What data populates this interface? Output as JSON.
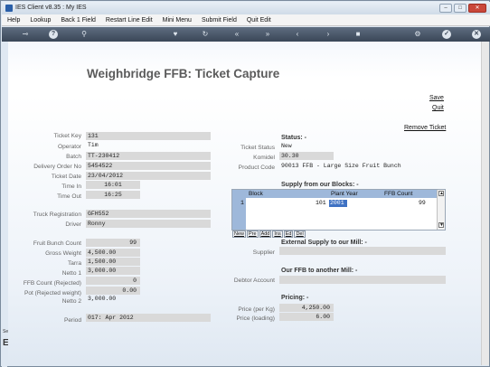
{
  "window": {
    "title": "IES Client v8.35 : My IES"
  },
  "menu": [
    "Help",
    "Lookup",
    "Back 1 Field",
    "Restart Line Edit",
    "Mini Menu",
    "Submit Field",
    "Quit Edit"
  ],
  "toolbar_icons": [
    "key-icon",
    "help-icon",
    "search-icon",
    "heart-icon",
    "refresh-icon",
    "rewind-icon",
    "fast-forward-icon",
    "back-icon",
    "forward-icon",
    "stop-icon",
    "settings-icon",
    "check-icon",
    "close-icon"
  ],
  "page": {
    "title": "Weighbridge FFB: Ticket Capture",
    "save": "Save",
    "quit": "Quit",
    "remove_ticket": "Remove Ticket"
  },
  "left": {
    "ticket_key": {
      "label": "Ticket Key",
      "value": "131"
    },
    "operator": {
      "label": "Operator",
      "value": "Tim"
    },
    "batch": {
      "label": "Batch",
      "value": "TT-230412"
    },
    "delivery_order_no": {
      "label": "Delivery Order No",
      "value": "5454522"
    },
    "ticket_date": {
      "label": "Ticket Date",
      "value": "23/04/2012"
    },
    "time_in": {
      "label": "Time In",
      "value": "16:01"
    },
    "time_out": {
      "label": "Time Out",
      "value": "16:25"
    },
    "truck_registration": {
      "label": "Truck Registration",
      "value": "GFH552"
    },
    "driver": {
      "label": "Driver",
      "value": "Ronny"
    },
    "fruit_bunch_count": {
      "label": "Fruit Bunch Count",
      "value": "99"
    },
    "gross_weight": {
      "label": "Gross Weight",
      "value": "4,500.00"
    },
    "tarra": {
      "label": "Tarra",
      "value": "1,500.00"
    },
    "netto_1": {
      "label": "Netto 1",
      "value": "3,000.00"
    },
    "ffb_count_rejected": {
      "label": "FFB Count (Rejected)",
      "value": "0"
    },
    "pot_rejected_weight": {
      "label": "Pot (Rejected weight)",
      "value": "0.00"
    },
    "netto_2": {
      "label": "Netto 2",
      "value": "3,000.00"
    },
    "period": {
      "label": "Period",
      "value": "017: Apr 2012"
    }
  },
  "right": {
    "status_heading": "Status: -",
    "ticket_status": {
      "label": "Ticket Status",
      "value": "New"
    },
    "komidel": {
      "label": "Komidel",
      "value": "30.30"
    },
    "product_code": {
      "label": "Product Code",
      "value": "90013 FFB - Large Size Fruit Bunch"
    },
    "supply_heading": "Supply from our Blocks: -",
    "grid": {
      "headers": [
        "Block",
        "Plant Year",
        "FFB Count"
      ],
      "rows": [
        {
          "row_no": "1",
          "block": "101",
          "plant_year": "2001",
          "ffb_count": "99"
        }
      ],
      "buttons": [
        "New",
        "Pre",
        "Add",
        "Ins",
        "Ed",
        "Del"
      ]
    },
    "external_heading": "External Supply to our Mill: -",
    "supplier": {
      "label": "Supplier",
      "value": ""
    },
    "ourffb_heading": "Our FFB to another Mill: -",
    "debtor_account": {
      "label": "Debtor Account",
      "value": ""
    },
    "pricing_heading": "Pricing: -",
    "price_per_kg": {
      "label": "Price (per Kg)",
      "value": "4,250.00"
    },
    "price_loading": {
      "label": "Price (loading)",
      "value": "6.00"
    }
  },
  "left_status": {
    "line1": "Ses",
    "line2": "E"
  }
}
